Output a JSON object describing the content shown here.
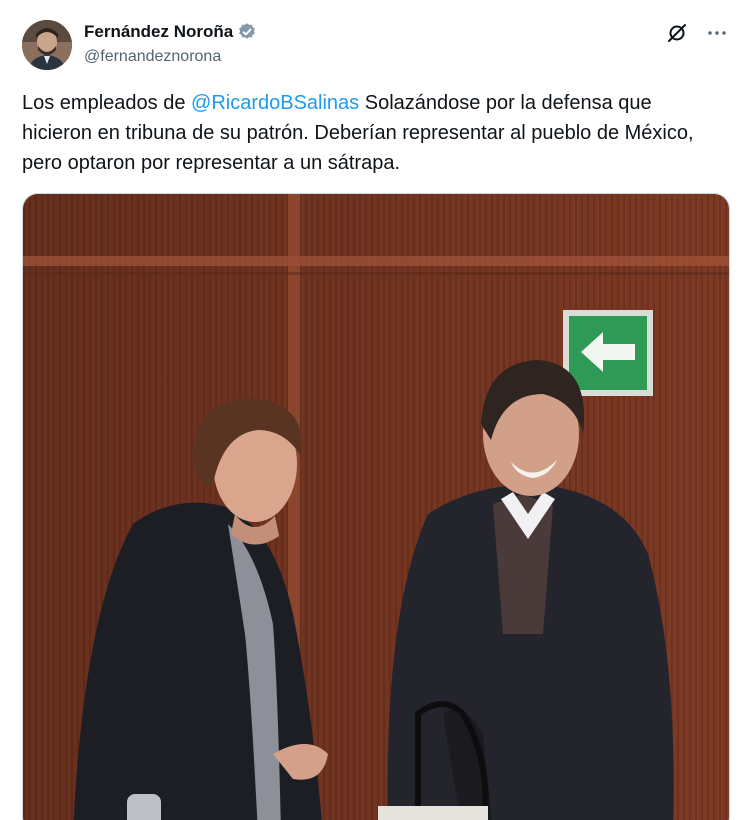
{
  "author": {
    "display_name": "Fernández Noroña",
    "handle": "@fernandeznorona",
    "verified_icon": "verified-badge-icon"
  },
  "actions": {
    "grok_icon": "grok-icon",
    "more_icon": "more-options-icon"
  },
  "tweet": {
    "text_before": "Los empleados de ",
    "mention": "@RicardoBSalinas",
    "text_after": " Solazándose por la defensa que hicieron en tribuna de su patrón. Deberían representar al pueblo de México, pero optaron por representar a un sátrapa."
  },
  "media": {
    "type": "photo",
    "exit_sign_icon": "exit-arrow-icon"
  },
  "colors": {
    "mention": "#1d9bf0",
    "verified": "#829aab",
    "text": "#0f1419",
    "secondary": "#536471"
  }
}
